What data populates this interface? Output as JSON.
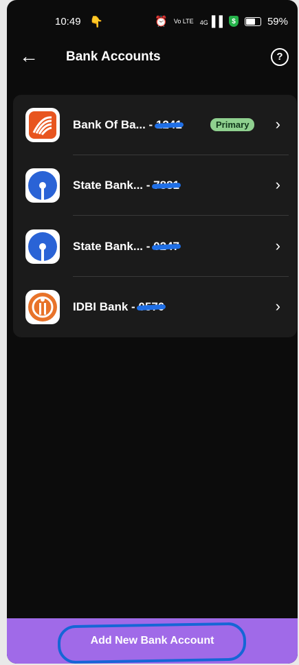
{
  "status_bar": {
    "time": "10:49",
    "battery": "59%",
    "battery_level": 0.59,
    "network_tiny": "Vo LTE",
    "signal_tiny": "4G",
    "icons": [
      "alarm-icon",
      "volte-icon",
      "signal-icon",
      "shield-dollar-icon",
      "battery-icon"
    ]
  },
  "header": {
    "title": "Bank Accounts",
    "help_glyph": "?"
  },
  "accounts": [
    {
      "name": "Bank Of Ba...",
      "separator": " - ",
      "masked": "1241",
      "badge": "Primary",
      "logo": "bank-of-baroda-logo"
    },
    {
      "name": "State Bank...",
      "separator": " - ",
      "masked": "7881",
      "badge": "",
      "logo": "sbi-logo"
    },
    {
      "name": "State Bank...",
      "separator": " - ",
      "masked": "0247",
      "badge": "",
      "logo": "sbi-logo"
    },
    {
      "name": "IDBI Bank",
      "separator": " - ",
      "masked": "0570",
      "badge": "",
      "logo": "idbi-logo"
    }
  ],
  "footer": {
    "add_label": "Add New Bank Account"
  },
  "colors": {
    "background": "#0c0c0c",
    "card": "#1b1b1b",
    "accent": "#a06ae8",
    "primary_badge": "#8fd08f",
    "scribble": "#1f6fe6"
  }
}
